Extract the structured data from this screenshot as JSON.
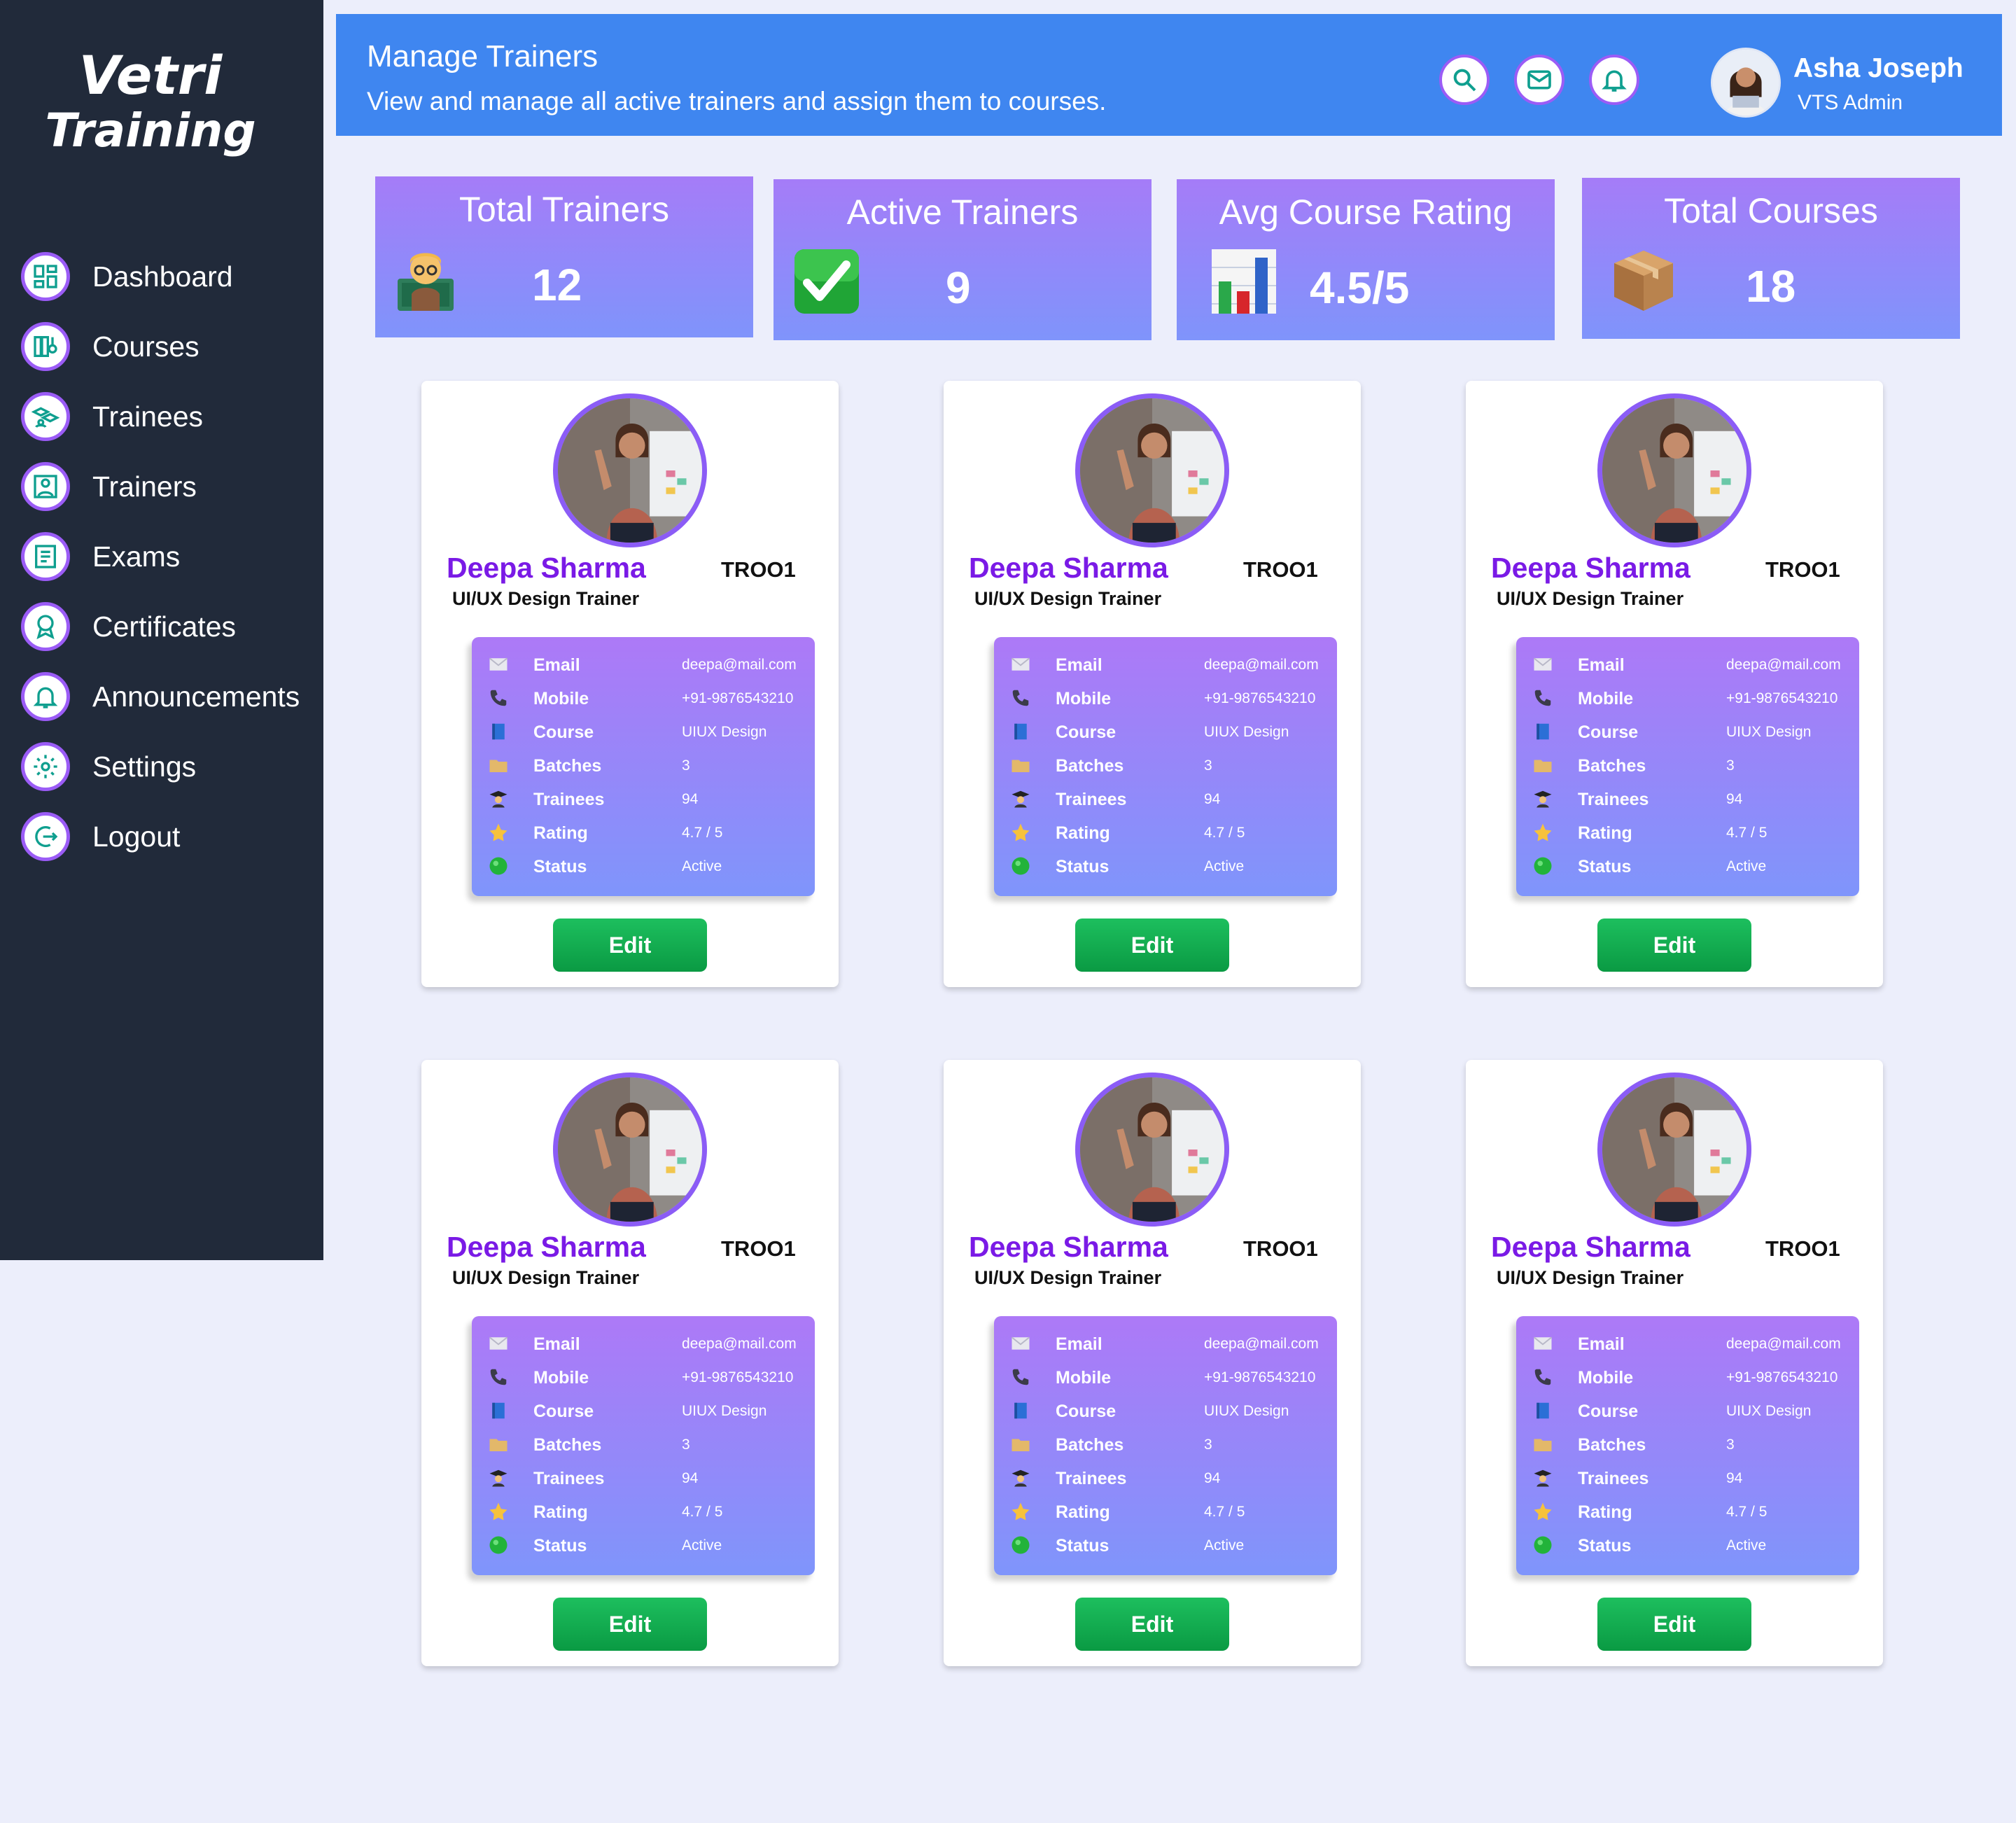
{
  "brand": {
    "line1": "Vetri",
    "line2": "Training"
  },
  "sidebar": {
    "items": [
      {
        "label": "Dashboard",
        "icon": "dashboard-icon"
      },
      {
        "label": "Courses",
        "icon": "courses-icon"
      },
      {
        "label": "Trainees",
        "icon": "trainees-icon"
      },
      {
        "label": "Trainers",
        "icon": "trainers-icon"
      },
      {
        "label": "Exams",
        "icon": "exams-icon"
      },
      {
        "label": "Certificates",
        "icon": "certificate-icon"
      },
      {
        "label": "Announcements",
        "icon": "bell-icon"
      },
      {
        "label": "Settings",
        "icon": "gear-icon"
      },
      {
        "label": "Logout",
        "icon": "logout-icon"
      }
    ]
  },
  "header": {
    "title": "Manage Trainers",
    "subtitle": "View and manage all active trainers and assign them to courses.",
    "user": {
      "name": "Asha Joseph",
      "role": "VTS Admin"
    }
  },
  "stats": [
    {
      "label": "Total Trainers",
      "value": "12",
      "emoji": "teacher"
    },
    {
      "label": "Active Trainers",
      "value": "9",
      "emoji": "check"
    },
    {
      "label": "Avg Course Rating",
      "value": "4.5/5",
      "emoji": "bar-chart"
    },
    {
      "label": "Total Courses",
      "value": "18",
      "emoji": "package"
    }
  ],
  "cards": [
    {
      "name": "Deepa Sharma",
      "id": "TROO1",
      "role": "UI/UX Design Trainer",
      "email": "deepa@mail.com",
      "mobile": "+91-9876543210",
      "course": "UIUX Design",
      "batches": "3",
      "trainees": "94",
      "rating": "4.7 / 5",
      "status": "Active",
      "edit": "Edit"
    },
    {
      "name": "Deepa Sharma",
      "id": "TROO1",
      "role": "UI/UX Design Trainer",
      "email": "deepa@mail.com",
      "mobile": "+91-9876543210",
      "course": "UIUX Design",
      "batches": "3",
      "trainees": "94",
      "rating": "4.7 / 5",
      "status": "Active",
      "edit": "Edit"
    },
    {
      "name": "Deepa Sharma",
      "id": "TROO1",
      "role": "UI/UX Design Trainer",
      "email": "deepa@mail.com",
      "mobile": "+91-9876543210",
      "course": "UIUX Design",
      "batches": "3",
      "trainees": "94",
      "rating": "4.7 / 5",
      "status": "Active",
      "edit": "Edit"
    },
    {
      "name": "Deepa Sharma",
      "id": "TROO1",
      "role": "UI/UX Design Trainer",
      "email": "deepa@mail.com",
      "mobile": "+91-9876543210",
      "course": "UIUX Design",
      "batches": "3",
      "trainees": "94",
      "rating": "4.7 / 5",
      "status": "Active",
      "edit": "Edit"
    },
    {
      "name": "Deepa Sharma",
      "id": "TROO1",
      "role": "UI/UX Design Trainer",
      "email": "deepa@mail.com",
      "mobile": "+91-9876543210",
      "course": "UIUX Design",
      "batches": "3",
      "trainees": "94",
      "rating": "4.7 / 5",
      "status": "Active",
      "edit": "Edit"
    },
    {
      "name": "Deepa Sharma",
      "id": "TROO1",
      "role": "UI/UX Design Trainer",
      "email": "deepa@mail.com",
      "mobile": "+91-9876543210",
      "course": "UIUX Design",
      "batches": "3",
      "trainees": "94",
      "rating": "4.7 / 5",
      "status": "Active",
      "edit": "Edit"
    }
  ],
  "field_labels": {
    "email": "Email",
    "mobile": "Mobile",
    "course": "Course",
    "batches": "Batches",
    "trainees": "Trainees",
    "rating": "Rating",
    "status": "Status"
  },
  "colors": {
    "sidebar": "#212a3a",
    "header": "#3f86f0",
    "accent": "#8b5cf6",
    "edit": "#0ea94b",
    "name": "#7a1ae6"
  }
}
